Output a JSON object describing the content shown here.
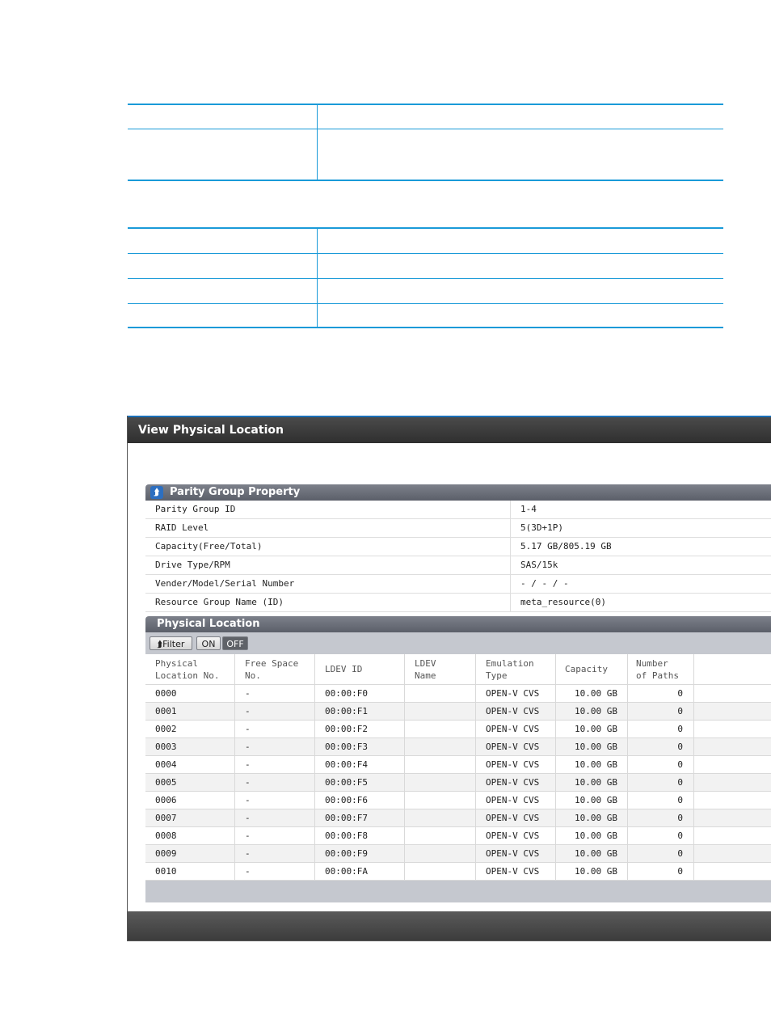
{
  "dialog": {
    "title": "View Physical Location",
    "parity_group": {
      "header": "Parity Group Property",
      "properties": [
        {
          "label": "Parity Group ID",
          "value": "1-4"
        },
        {
          "label": "RAID Level",
          "value": "5(3D+1P)"
        },
        {
          "label": "Capacity(Free/Total)",
          "value": "5.17 GB/805.19 GB"
        },
        {
          "label": "Drive Type/RPM",
          "value": "SAS/15k"
        },
        {
          "label": "Vender/Model/Serial Number",
          "value": "- / - / -"
        },
        {
          "label": "Resource Group Name (ID)",
          "value": "meta_resource(0)"
        }
      ]
    },
    "physical_location": {
      "header": "Physical Location",
      "filter": {
        "label": "Filter",
        "on_label": "ON",
        "off_label": "OFF",
        "state": "OFF"
      },
      "columns": [
        "Physical\nLocation No.",
        "Free Space\nNo.",
        "LDEV ID",
        "LDEV\nName",
        "Emulation\nType",
        "Capacity",
        "Number\nof Paths"
      ],
      "rows": [
        [
          "0000",
          "-",
          "00:00:F0",
          "",
          "OPEN-V CVS",
          "10.00 GB",
          "0"
        ],
        [
          "0001",
          "-",
          "00:00:F1",
          "",
          "OPEN-V CVS",
          "10.00 GB",
          "0"
        ],
        [
          "0002",
          "-",
          "00:00:F2",
          "",
          "OPEN-V CVS",
          "10.00 GB",
          "0"
        ],
        [
          "0003",
          "-",
          "00:00:F3",
          "",
          "OPEN-V CVS",
          "10.00 GB",
          "0"
        ],
        [
          "0004",
          "-",
          "00:00:F4",
          "",
          "OPEN-V CVS",
          "10.00 GB",
          "0"
        ],
        [
          "0005",
          "-",
          "00:00:F5",
          "",
          "OPEN-V CVS",
          "10.00 GB",
          "0"
        ],
        [
          "0006",
          "-",
          "00:00:F6",
          "",
          "OPEN-V CVS",
          "10.00 GB",
          "0"
        ],
        [
          "0007",
          "-",
          "00:00:F7",
          "",
          "OPEN-V CVS",
          "10.00 GB",
          "0"
        ],
        [
          "0008",
          "-",
          "00:00:F8",
          "",
          "OPEN-V CVS",
          "10.00 GB",
          "0"
        ],
        [
          "0009",
          "-",
          "00:00:F9",
          "",
          "OPEN-V CVS",
          "10.00 GB",
          "0"
        ],
        [
          "0010",
          "-",
          "00:00:FA",
          "",
          "OPEN-V CVS",
          "10.00 GB",
          "0"
        ]
      ]
    }
  },
  "icons": {
    "collapse": "double-chevron-up-icon",
    "filter": "double-chevron-up-icon"
  },
  "colors": {
    "rule_blue": "#1a9ad8",
    "title_bar": "#3a3a3a",
    "section_header": "#6b6f79"
  }
}
